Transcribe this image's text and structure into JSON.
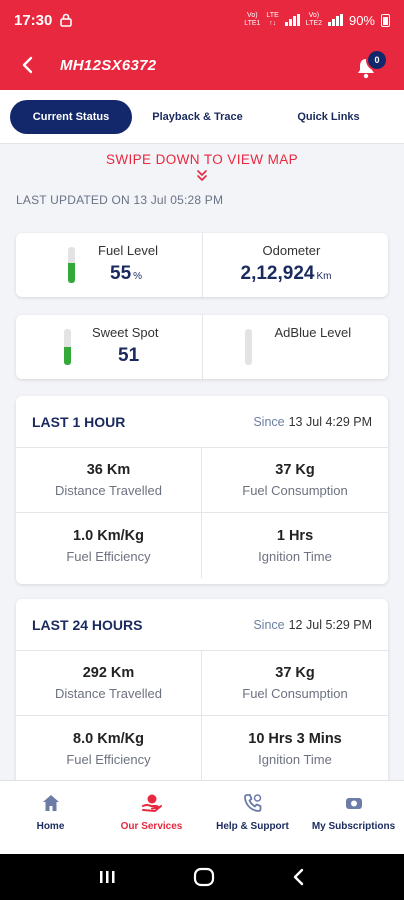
{
  "status_bar": {
    "time": "17:30",
    "battery": "90%",
    "signal_1": "VoLTE 1",
    "signal_2": "VoLTE 2"
  },
  "header": {
    "title": "MH12SX6372",
    "notification_count": "0"
  },
  "tabs": [
    {
      "label": "Current Status",
      "active": true
    },
    {
      "label": "Playback & Trace",
      "active": false
    },
    {
      "label": "Quick Links",
      "active": false
    }
  ],
  "swipe_hint": "SWIPE DOWN TO VIEW MAP",
  "last_updated": "LAST UPDATED ON 13 Jul 05:28 PM",
  "fuel": {
    "label": "Fuel Level",
    "value": "55",
    "unit": "%",
    "gauge_level": 0.55
  },
  "odometer": {
    "label": "Odometer",
    "value": "2,12,924",
    "unit": "Km"
  },
  "sweet_spot": {
    "label": "Sweet Spot",
    "value": "51",
    "gauge_level": 0.51
  },
  "adblue": {
    "label": "AdBlue Level",
    "gauge_level": 0
  },
  "last_hour": {
    "title": "LAST 1 HOUR",
    "since_label": "Since",
    "since_value": "13 Jul 4:29 PM",
    "distance": {
      "value": "36 Km",
      "label": "Distance Travelled"
    },
    "fuel_consumption": {
      "value": "37 Kg",
      "label": "Fuel Consumption"
    },
    "fuel_efficiency": {
      "value": "1.0 Km/Kg",
      "label": "Fuel Efficiency"
    },
    "ignition": {
      "value": "1 Hrs",
      "label": "Ignition Time"
    }
  },
  "last_24": {
    "title": "LAST 24 HOURS",
    "since_label": "Since",
    "since_value": "12 Jul 5:29 PM",
    "distance": {
      "value": "292 Km",
      "label": "Distance Travelled"
    },
    "fuel_consumption": {
      "value": "37 Kg",
      "label": "Fuel Consumption"
    },
    "fuel_efficiency": {
      "value": "8.0 Km/Kg",
      "label": "Fuel Efficiency"
    },
    "ignition": {
      "value": "10 Hrs 3 Mins",
      "label": "Ignition Time"
    }
  },
  "bottom_nav": [
    {
      "label": "Home",
      "icon": "home-icon",
      "active": false
    },
    {
      "label": "Our Services",
      "icon": "services-icon",
      "active": true
    },
    {
      "label": "Help & Support",
      "icon": "phone-icon",
      "active": false
    },
    {
      "label": "My Subscriptions",
      "icon": "subscription-icon",
      "active": false
    }
  ],
  "colors": {
    "brand_red": "#e8283f",
    "navy": "#13286b",
    "gauge_green": "#35a83a"
  }
}
